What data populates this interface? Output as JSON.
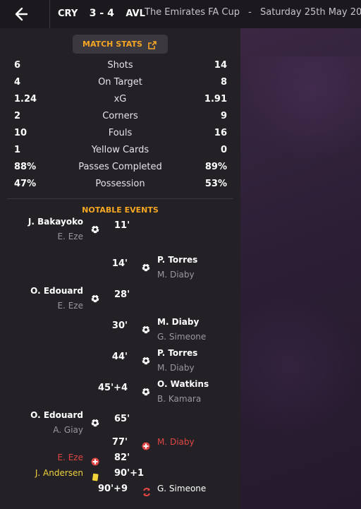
{
  "header": {
    "back_icon": "arrow-left-icon",
    "home_abbr": "CRY",
    "score": "3 - 4",
    "away_abbr": "AVL",
    "competition": "The Emirates FA Cup",
    "separator": "-",
    "date": "Saturday 25th May 2024"
  },
  "stats_tab": {
    "label": "MATCH STATS",
    "icon": "external-link-icon"
  },
  "stats": [
    {
      "home": "6",
      "label": "Shots",
      "away": "14"
    },
    {
      "home": "4",
      "label": "On Target",
      "away": "8"
    },
    {
      "home": "1.24",
      "label": "xG",
      "away": "1.91"
    },
    {
      "home": "2",
      "label": "Corners",
      "away": "9"
    },
    {
      "home": "10",
      "label": "Fouls",
      "away": "16"
    },
    {
      "home": "1",
      "label": "Yellow Cards",
      "away": "0"
    },
    {
      "home": "88%",
      "label": "Passes Completed",
      "away": "89%"
    },
    {
      "home": "47%",
      "label": "Possession",
      "away": "53%"
    }
  ],
  "events_title": "NOTABLE EVENTS",
  "events": [
    {
      "side": "home",
      "type": "goal",
      "minute": "11'",
      "player": "J. Bakayoko",
      "assist": "E. Eze"
    },
    {
      "side": "away",
      "type": "goal",
      "minute": "14'",
      "player": "P. Torres",
      "assist": "M. Diaby"
    },
    {
      "side": "home",
      "type": "goal",
      "minute": "28'",
      "player": "O. Edouard",
      "assist": "E. Eze"
    },
    {
      "side": "away",
      "type": "goal",
      "minute": "30'",
      "player": "M. Diaby",
      "assist": "G. Simeone"
    },
    {
      "side": "away",
      "type": "goal",
      "minute": "44'",
      "player": "P. Torres",
      "assist": "M. Diaby"
    },
    {
      "side": "away",
      "type": "goal",
      "minute": "45'+4",
      "player": "O. Watkins",
      "assist": "B. Kamara"
    },
    {
      "side": "home",
      "type": "goal",
      "minute": "65'",
      "player": "O. Edouard",
      "assist": "A. Giay"
    },
    {
      "side": "away",
      "type": "injury",
      "minute": "77'",
      "player": "M. Diaby"
    },
    {
      "side": "home",
      "type": "injury",
      "minute": "82'",
      "player": "E. Eze"
    },
    {
      "side": "home",
      "type": "yellow-card",
      "minute": "90'+1",
      "player": "J. Andersen"
    },
    {
      "side": "away",
      "type": "substitution",
      "minute": "90'+9",
      "player": "G. Simeone"
    }
  ],
  "colors": {
    "accent": "#f5a623",
    "injury": "#e04545",
    "yellow": "#f0d23a"
  }
}
